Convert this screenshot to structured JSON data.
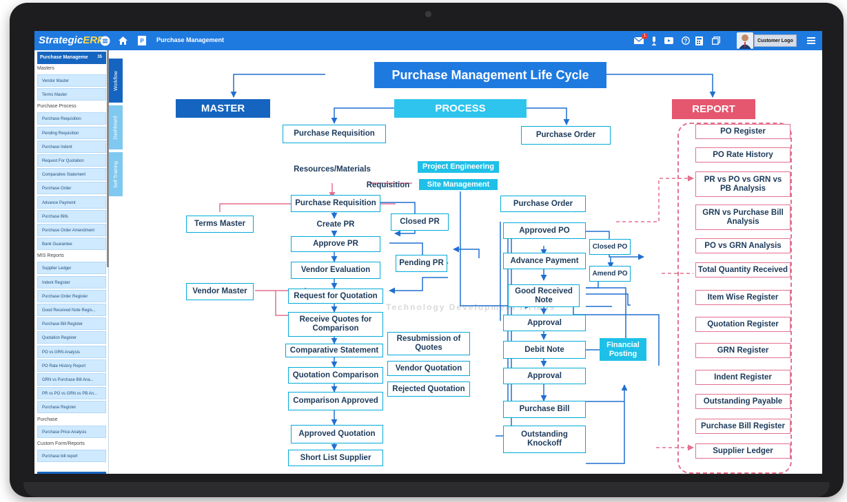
{
  "app": {
    "logo_main": "Strategic",
    "logo_accent": "ERP",
    "breadcrumb": "Purchase Management",
    "notification_count": "1",
    "customer_logo": "Customer Logo",
    "colors": {
      "topbar": "#1f7ae0",
      "sidebar_item": "#cfe9ff",
      "sidebar_head": "#1565c0",
      "process_border": "#00a9d8",
      "report_border": "#e46f8e"
    }
  },
  "sidebar": {
    "header": "Purchase Manageme",
    "header_count": "35",
    "vertical_tabs": [
      "Workflow",
      "Dashboard",
      "Self Training"
    ],
    "sections": [
      {
        "label": "Masters",
        "items": [
          "Vendor Master",
          "Terms Master"
        ]
      },
      {
        "label": "Purchase Process",
        "items": [
          "Purchase Requisition",
          "Pending Requisition",
          "Purchase Indent",
          "Request For Quotation",
          "Comparative Statement",
          "Purchase Order",
          "Advance Payment",
          "Purchase Bills",
          "Purchase Order Amendment",
          "Bank Guarantee"
        ]
      },
      {
        "label": "MIS Reports",
        "items": [
          "Supplier Ledger",
          "Indent Register",
          "Purchase Order Register",
          "Good Received Note Regis...",
          "Purchase Bill Register",
          "Quotation Register",
          "PO vs GRN Analysis",
          "PO Rate History Report",
          "GRN vs Purchase Bill Ana...",
          "PR vs PO vs GRN vs PB An...",
          "Purchase Register"
        ]
      },
      {
        "label": "Purchase",
        "items": [
          "Purchase Price Analysis"
        ]
      },
      {
        "label": "Custom Form/Reports",
        "items": [
          "Purchase bill report"
        ]
      }
    ]
  },
  "diagram": {
    "title": "Purchase Management Life Cycle",
    "master": {
      "header": "MASTER",
      "terms_master": "Terms Master",
      "vendor_master": "Vendor Master"
    },
    "process": {
      "header": "PROCESS",
      "purchase_requisition_top": "Purchase Requisition",
      "purchase_order_top": "Purchase Order",
      "resources_label": "Resources/Materials",
      "project_engineering": "Project Engineering",
      "requisition_label": "Requisition",
      "site_management": "Site Management",
      "left_column": {
        "purchase_requisition": "Purchase Requisition",
        "create_pr": "Create PR",
        "approve_pr": "Approve PR",
        "vendor_evaluation": "Vendor Evaluation",
        "request_for_quotation": "Request for Quotation",
        "receive_quotes": "Receive Quotes for Comparison",
        "comparative_statement": "Comparative Statement",
        "quotation_comparison": "Quotation Comparison",
        "comparison_approved": "Comparison Approved",
        "approved_quotation": "Approved Quotation",
        "short_list_supplier": "Short List Supplier"
      },
      "middle_column": {
        "closed_pr": "Closed PR",
        "pending_pr": "Pending PR",
        "resubmission": "Resubmission of Quotes",
        "vendor_quotation": "Vendor Quotation",
        "rejected_quotation": "Rejected Quotation"
      },
      "right_column": {
        "purchase_order": "Purchase Order",
        "approved_po": "Approved PO",
        "closed_po": "Closed PO",
        "advance_payment": "Advance Payment",
        "amend_po": "Amend PO",
        "good_received_note": "Good Received Note",
        "approval_1": "Approval",
        "debit_note": "Debit Note",
        "financial_posting": "Financial Posting",
        "approval_2": "Approval",
        "purchase_bill": "Purchase Bill",
        "outstanding_knockoff": "Outstanding Knockoff"
      }
    },
    "report": {
      "header": "REPORT",
      "items": [
        "PO Register",
        "PO Rate History",
        "PR vs PO vs GRN vs PB Analysis",
        "GRN vs Purchase Bill Analysis",
        "PO vs GRN Analysis",
        "Total Quantity Received",
        "Item Wise Register",
        "Quotation Register",
        "GRN Register",
        "Indent Register",
        "Outstanding Payable",
        "Purchase Bill Register",
        "Supplier Ledger"
      ]
    },
    "watermark": "Technology Development IITians"
  }
}
